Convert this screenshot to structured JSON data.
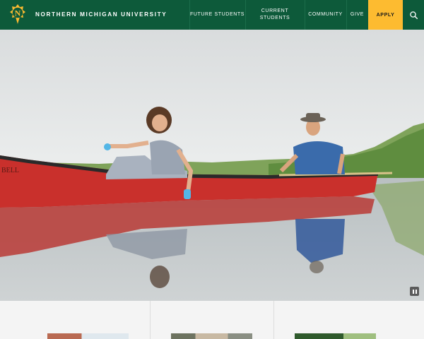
{
  "header": {
    "brand": "NORTHERN MICHIGAN UNIVERSITY",
    "nav": {
      "future_students": "FUTURE STUDENTS",
      "current_students_line1": "CURRENT",
      "current_students_line2": "STUDENTS",
      "community": "COMMUNITY",
      "give": "GIVE",
      "apply": "APPLY"
    },
    "icons": {
      "logo": "nmu-n-logo-icon",
      "search": "search-icon"
    }
  },
  "hero": {
    "pause": "pause-icon"
  },
  "colors": {
    "brand_green": "#0d5a3a",
    "apply_gold": "#fdbb30"
  }
}
